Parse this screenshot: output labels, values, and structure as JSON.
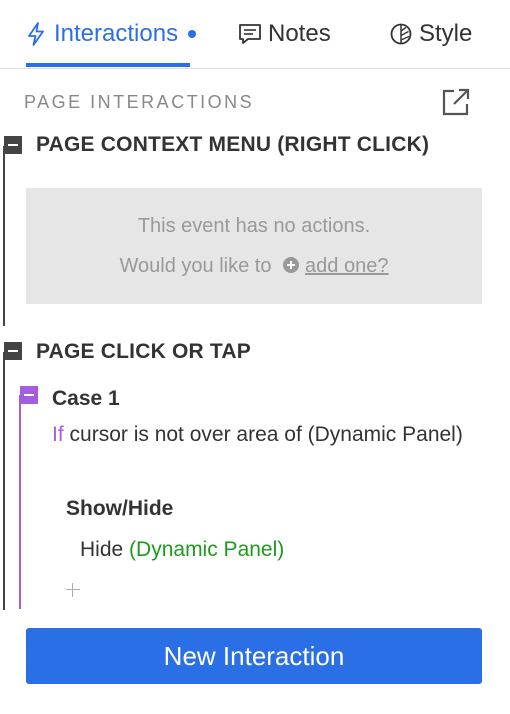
{
  "tabs": {
    "interactions": {
      "label": "Interactions",
      "icon": "lightning-icon",
      "active": true,
      "has_indicator": true
    },
    "notes": {
      "label": "Notes",
      "icon": "note-icon"
    },
    "style": {
      "label": "Style",
      "icon": "leaf-icon"
    }
  },
  "section": {
    "title": "PAGE INTERACTIONS",
    "popout_icon": "popout-icon"
  },
  "events": [
    {
      "title": "PAGE CONTEXT MENU (RIGHT CLICK)",
      "empty": {
        "line1": "This event has no actions.",
        "line2_prefix": "Would you like to",
        "link": "add one?"
      }
    },
    {
      "title": "PAGE CLICK OR TAP",
      "cases": [
        {
          "title": "Case 1",
          "condition_keyword": "If",
          "condition_text": "cursor is not over area of (Dynamic Panel)",
          "actions": [
            {
              "group": "Show/Hide",
              "verb": "Hide",
              "target": "(Dynamic Panel)"
            }
          ]
        }
      ]
    }
  ],
  "footer": {
    "new_interaction_label": "New Interaction"
  },
  "colors": {
    "accent": "#2b6fe6",
    "case": "#a55de0",
    "target": "#1e9a1e",
    "muted": "#999999"
  }
}
